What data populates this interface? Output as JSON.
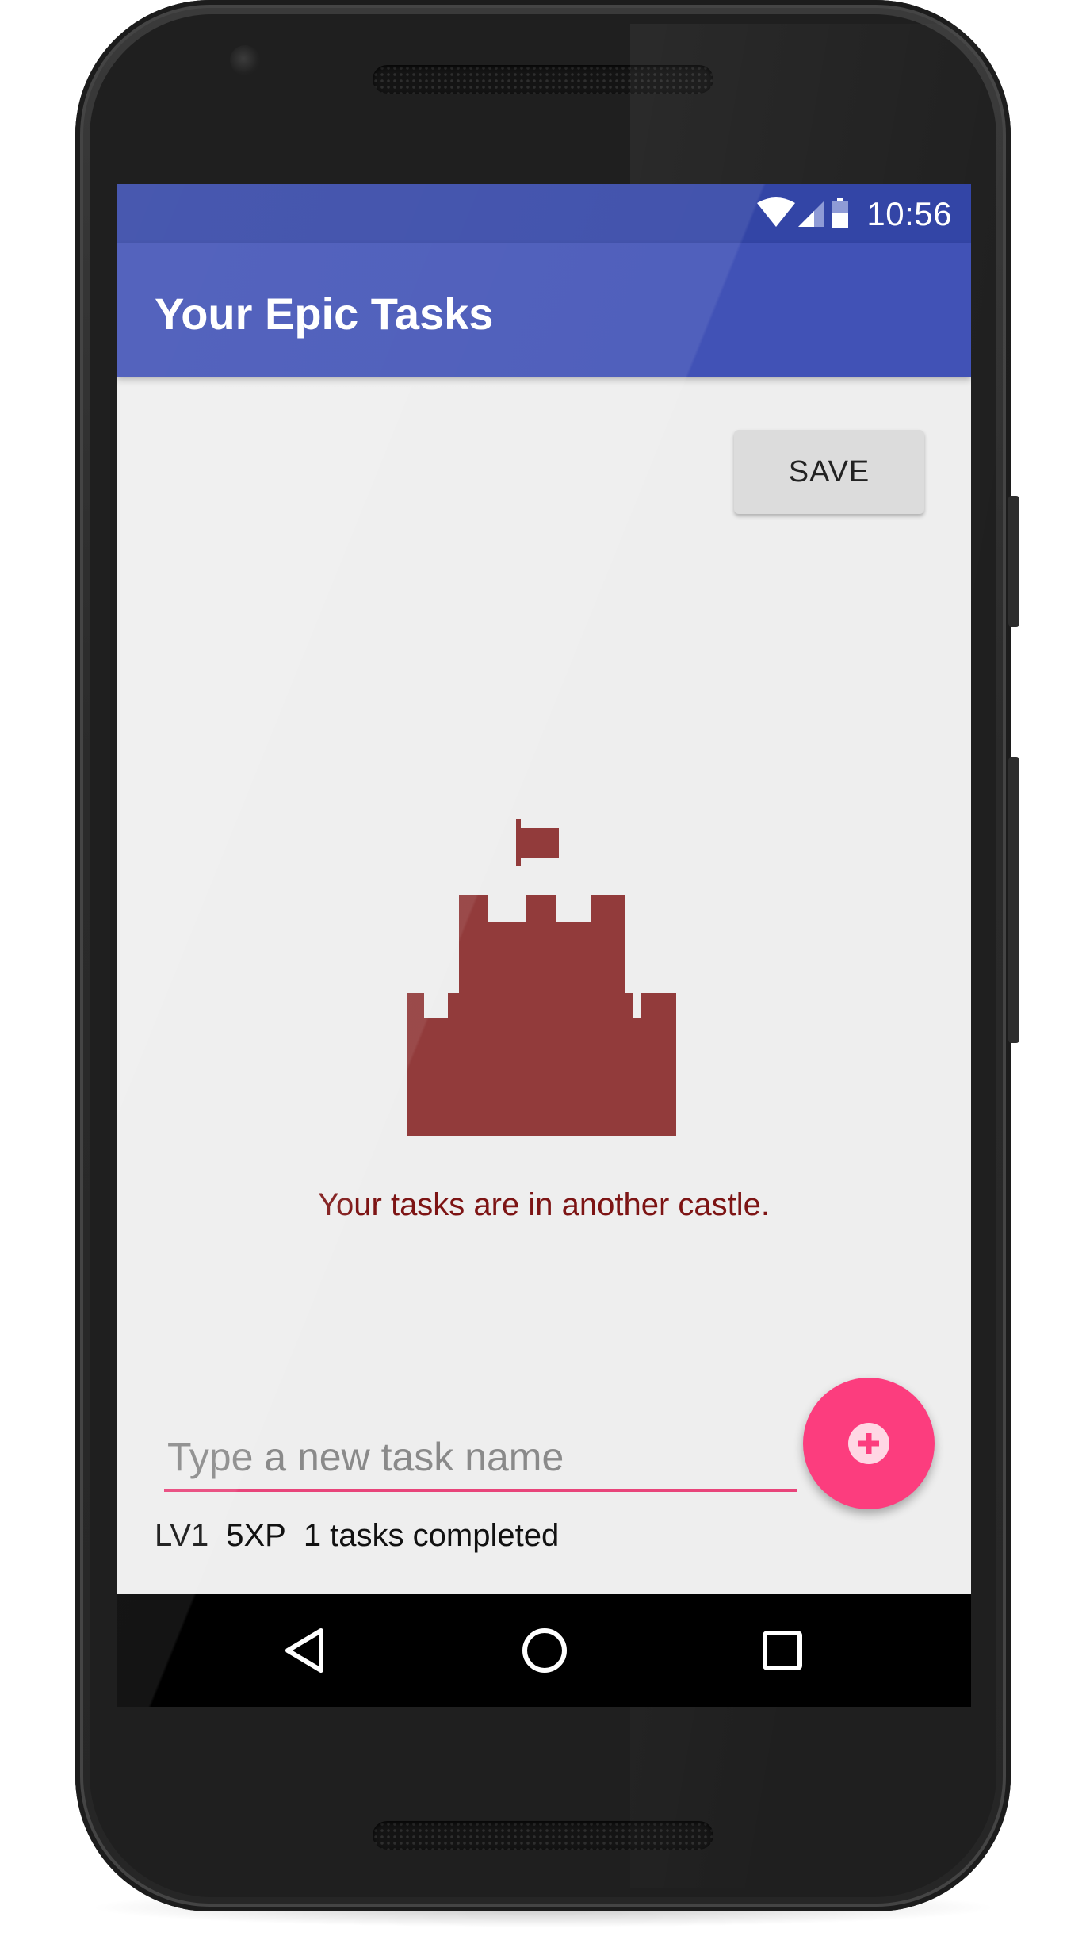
{
  "status_bar": {
    "time": "10:56",
    "icons": [
      "wifi-icon",
      "signal-icon",
      "battery-icon"
    ],
    "color": "#3345a6"
  },
  "app_bar": {
    "title": "Your Epic Tasks",
    "color": "#4152b6"
  },
  "toolbar": {
    "save_label": "SAVE"
  },
  "empty_state": {
    "icon": "castle-icon",
    "message": "Your tasks are in another castle.",
    "icon_color": "#923b3b",
    "message_color": "#7d1414"
  },
  "task_input": {
    "value": "",
    "placeholder": "Type a new task name",
    "underline_color": "#e8447a"
  },
  "fab": {
    "icon": "add-circle-icon",
    "color": "#fc3d7e"
  },
  "stats": {
    "level": "LV1",
    "xp": "5XP",
    "completed": "1 tasks completed"
  },
  "nav_bar": {
    "buttons": [
      "back-icon",
      "home-icon",
      "recents-icon"
    ]
  }
}
